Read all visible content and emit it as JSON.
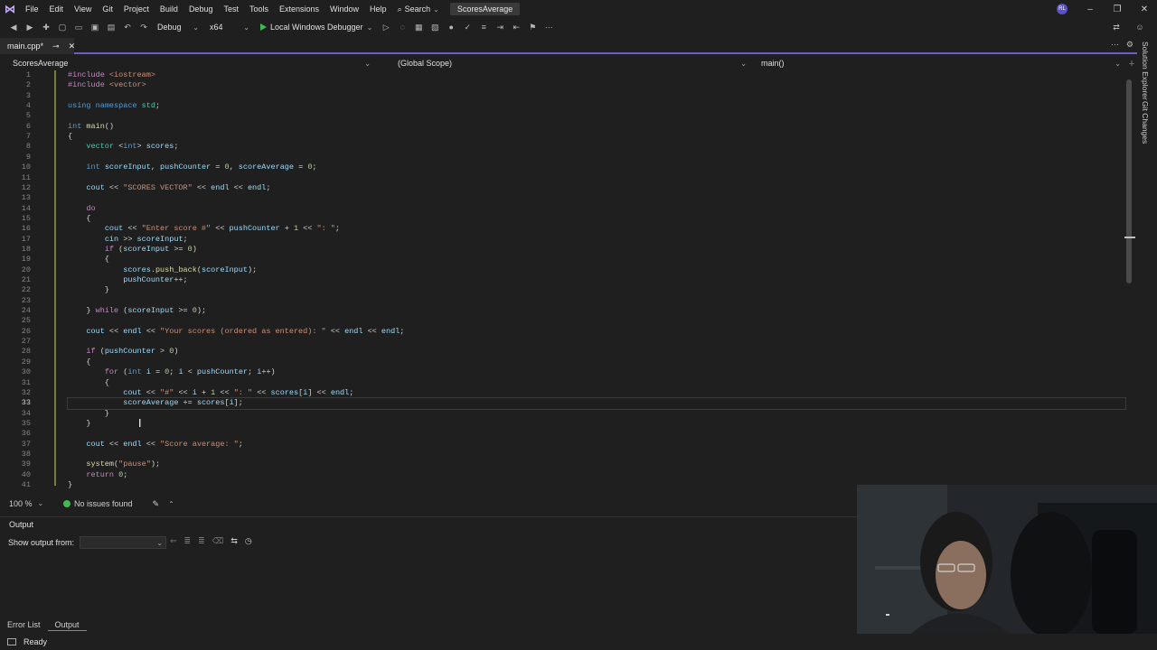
{
  "menubar": {
    "items": [
      "File",
      "Edit",
      "View",
      "Git",
      "Project",
      "Build",
      "Debug",
      "Test",
      "Tools",
      "Extensions",
      "Window",
      "Help"
    ],
    "search_label": "Search",
    "solution_title": "ScoresAverage",
    "avatar_initials": "RL"
  },
  "toolbar": {
    "configuration": "Debug",
    "platform": "x64",
    "run_label": "Local Windows Debugger"
  },
  "tabs": {
    "active_file": "main.cpp*"
  },
  "navbar": {
    "project": "ScoresAverage",
    "scope": "(Global Scope)",
    "member": "main()"
  },
  "editor": {
    "active_line": 33,
    "lines": [
      "#include <iostream>",
      "#include <vector>",
      "",
      "using namespace std;",
      "",
      "int main()",
      "{",
      "    vector <int> scores;",
      "",
      "    int scoreInput, pushCounter = 0, scoreAverage = 0;",
      "",
      "    cout << \"SCORES VECTOR\" << endl << endl;",
      "",
      "    do",
      "    {",
      "        cout << \"Enter score #\" << pushCounter + 1 << \": \";",
      "        cin >> scoreInput;",
      "        if (scoreInput >= 0)",
      "        {",
      "            scores.push_back(scoreInput);",
      "            pushCounter++;",
      "        }",
      "",
      "    } while (scoreInput >= 0);",
      "",
      "    cout << endl << \"Your scores (ordered as entered): \" << endl << endl;",
      "",
      "    if (pushCounter > 0)",
      "    {",
      "        for (int i = 0; i < pushCounter; i++)",
      "        {",
      "            cout << \"#\" << i + 1 << \": \" << scores[i] << endl;",
      "            scoreAverage += scores[i];",
      "        }",
      "    }",
      "",
      "    cout << endl << \"Score average: \";",
      "",
      "    system(\"pause\");",
      "    return 0;",
      "}"
    ]
  },
  "editor_status": {
    "zoom": "100 %",
    "issues": "No issues found"
  },
  "output": {
    "title": "Output",
    "show_output_from": "Show output from:",
    "source_value": ""
  },
  "bottom_tabs": [
    "Error List",
    "Output"
  ],
  "status": {
    "text": "Ready"
  },
  "right_sidebar": {
    "tabs": [
      "Solution Explorer",
      "Git Changes"
    ]
  },
  "colors": {
    "accent": "#6e5cc7",
    "background": "#1f1f1f",
    "keyword": "#569cd6",
    "string": "#ce9178",
    "type": "#4ec9b0",
    "function": "#dcdcaa",
    "variable": "#9cdcfe",
    "success": "#3fb950"
  }
}
